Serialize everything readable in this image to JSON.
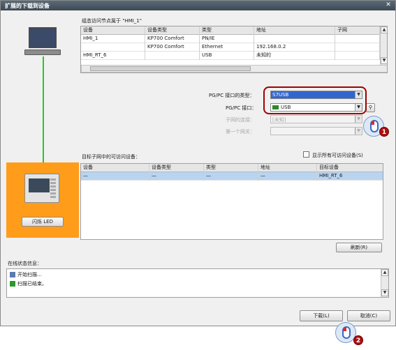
{
  "window": {
    "title": "扩展的下载到设备",
    "close_glyph": "✕"
  },
  "config": {
    "caption": "组态访问节点属于 \"HMI_1\"",
    "columns": [
      "设备",
      "设备类型",
      "类型",
      "地址",
      "子网"
    ],
    "rows": [
      [
        "HMI_1",
        "KP700 Comfort",
        "PN/IE",
        "",
        ""
      ],
      [
        "",
        "KP700 Comfort",
        "Ethernet",
        "192.168.0.2",
        ""
      ],
      [
        "HMI_RT_6",
        "",
        "USB",
        "未知的",
        ""
      ]
    ]
  },
  "interface": {
    "type_label": "PG/PC 接口的类型：",
    "type_value": "S7USB",
    "iface_label": "PG/PC 接口：",
    "iface_value": "USB",
    "connect_label": "子网的连接：",
    "connect_value": "[未知]",
    "gateway_label": "第一个网关：",
    "gateway_value": ""
  },
  "target": {
    "caption": "目标子网中的可访问设备：",
    "show_all_label": "显示所有可访问设备(S)",
    "columns": [
      "设备",
      "设备类型",
      "类型",
      "地址",
      "目标设备"
    ],
    "rows": [
      [
        "—",
        "—",
        "—",
        "—",
        "HMI_RT_6"
      ]
    ]
  },
  "flash_button": "闪烁 LED",
  "refresh_button": "刷新(R)",
  "status": {
    "caption": "在线状态信息：",
    "lines": [
      "开始扫描…",
      "扫描已结束。"
    ]
  },
  "download_button": "下载(L)",
  "cancel_button": "取消(C)",
  "badges": [
    "1",
    "2"
  ],
  "colors": {
    "highlight": "#3366cc",
    "link_line": "#22cc22",
    "device_panel": "#ff9c1a",
    "selected_row": "#b8d4f0",
    "badge": "#b01010"
  }
}
